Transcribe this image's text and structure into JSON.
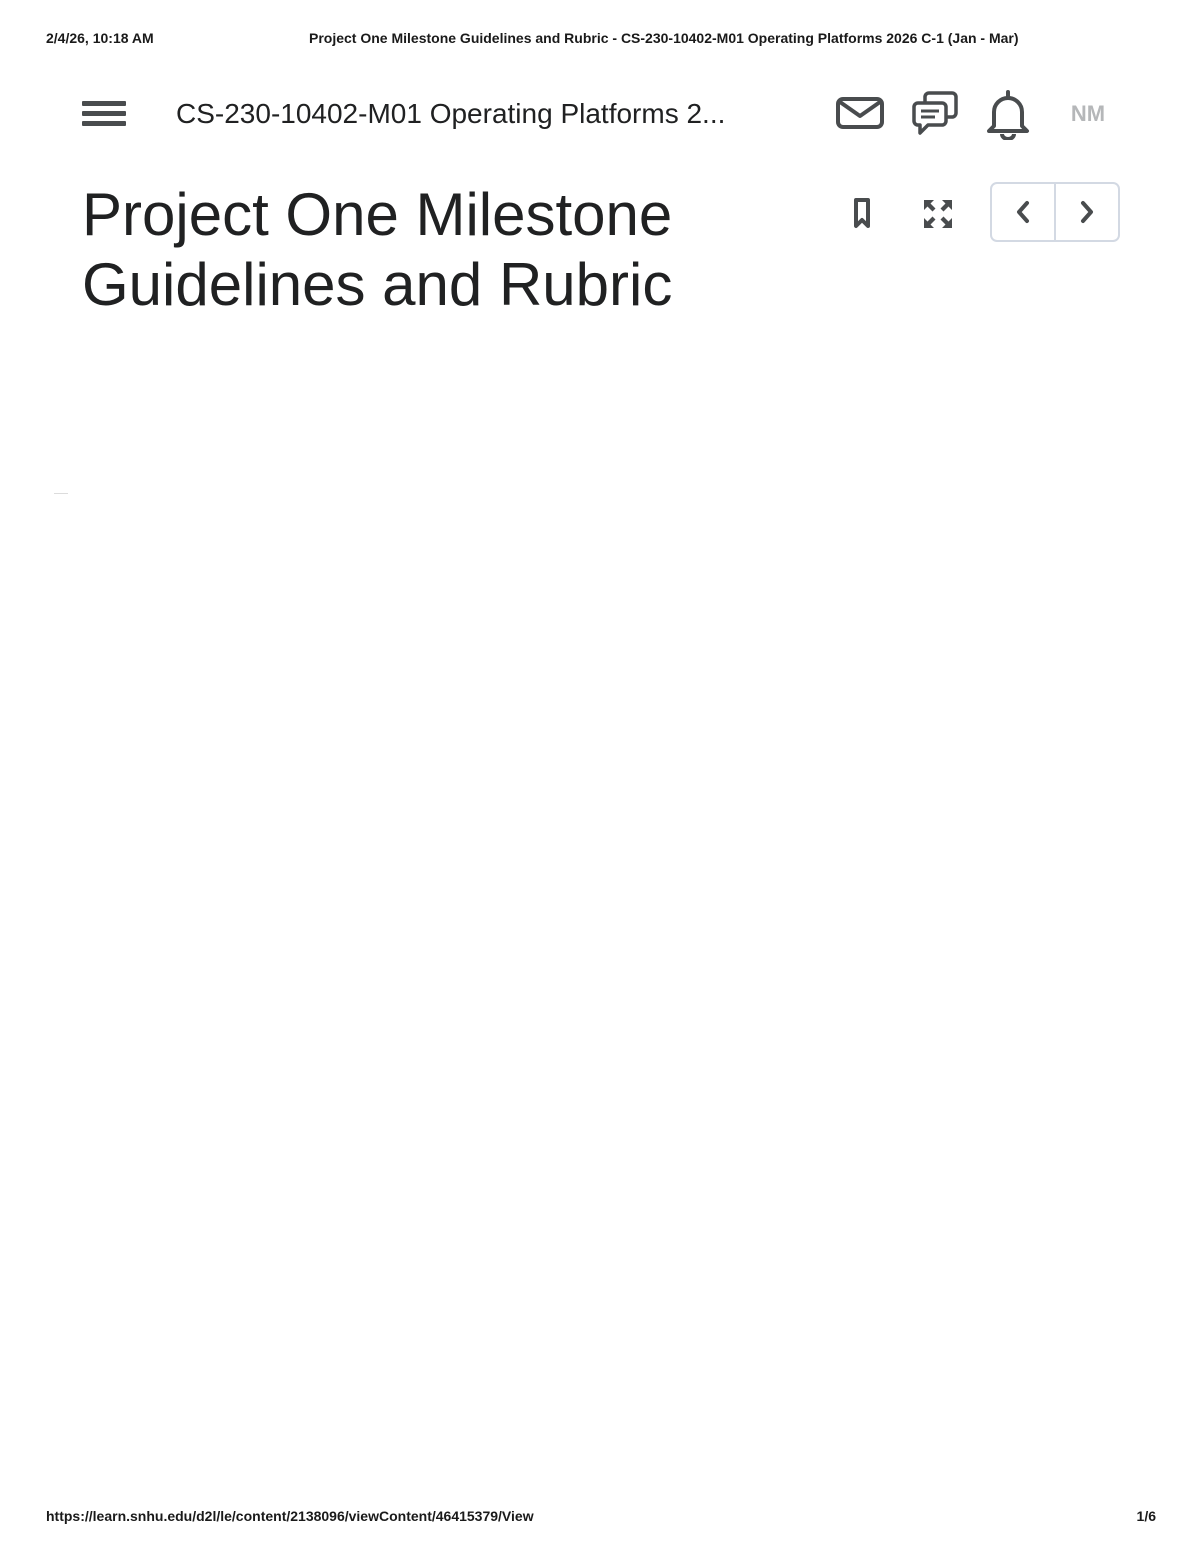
{
  "print_header": {
    "datetime": "2/4/26, 10:18 AM",
    "document_title": "Project One Milestone Guidelines and Rubric - CS-230-10402-M01 Operating Platforms 2026 C-1 (Jan - Mar)"
  },
  "navbar": {
    "menu_icon": "hamburger-menu-icon",
    "course_title": "CS-230-10402-M01 Operating Platforms 2...",
    "mail_icon": "mail-icon",
    "chat_icon": "chat-icon",
    "notifications_icon": "bell-icon",
    "user_initials": "NM"
  },
  "content": {
    "title": "Project One Milestone Guidelines and Rubric",
    "bookmark_icon": "bookmark-icon",
    "fullscreen_icon": "fullscreen-icon",
    "prev_icon": "chevron-left-icon",
    "next_icon": "chevron-right-icon"
  },
  "print_footer": {
    "url": "https://learn.snhu.edu/d2l/le/content/2138096/viewContent/46415379/View",
    "page_indicator": "1/6"
  },
  "colors": {
    "text": "#202122",
    "icon": "#494c4e",
    "avatar_text": "#b5b7b9",
    "pager_border": "#d3d9e3"
  }
}
